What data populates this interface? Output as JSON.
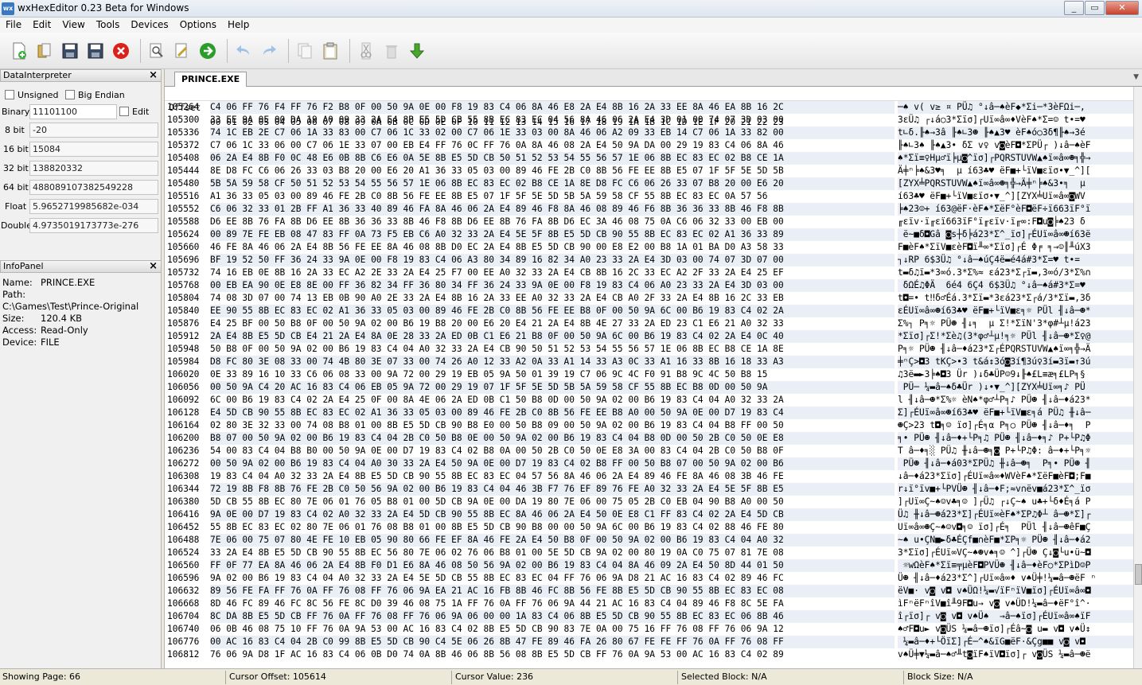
{
  "window": {
    "title": "wxHexEditor 0.23 Beta for Windows",
    "icon_text": "wx"
  },
  "menu": [
    "File",
    "Edit",
    "View",
    "Tools",
    "Devices",
    "Options",
    "Help"
  ],
  "toolbar": [
    {
      "name": "new-file-icon"
    },
    {
      "name": "open-file-icon"
    },
    {
      "name": "save-icon"
    },
    {
      "name": "save-as-icon"
    },
    {
      "name": "close-file-icon"
    },
    {
      "name": "find-icon"
    },
    {
      "name": "replace-icon"
    },
    {
      "name": "goto-icon"
    },
    {
      "name": "undo-icon"
    },
    {
      "name": "redo-icon"
    },
    {
      "name": "copy-icon"
    },
    {
      "name": "paste-icon"
    },
    {
      "name": "cut-icon"
    },
    {
      "name": "delete-icon"
    },
    {
      "name": "insert-icon"
    }
  ],
  "data_interpreter": {
    "title": "DataInterpreter",
    "unsigned_label": "Unsigned",
    "big_endian_label": "Big Endian",
    "edit_label": "Edit",
    "rows": [
      {
        "label": "Binary",
        "value": "11101100"
      },
      {
        "label": "8 bit",
        "value": "-20"
      },
      {
        "label": "16 bit",
        "value": "15084"
      },
      {
        "label": "32 bit",
        "value": "138820332"
      },
      {
        "label": "64 bit",
        "value": "488089107382549228"
      },
      {
        "label": "Float",
        "value": "5.9652719985682e-034"
      },
      {
        "label": "Double",
        "value": "4.9735019173773e-276"
      }
    ]
  },
  "info_panel": {
    "title": "InfoPanel",
    "lines": [
      {
        "label": "Name:",
        "value": "PRINCE.EXE"
      },
      {
        "label": "Path:",
        "value": ""
      },
      {
        "label": "",
        "value": "C:\\Games\\Test\\Prince-Original"
      },
      {
        "label": "Size:",
        "value": "120.4 KB"
      },
      {
        "label": "Access:",
        "value": "Read-Only"
      },
      {
        "label": "Device:",
        "value": "FILE"
      }
    ]
  },
  "tab": {
    "label": "PRINCE.EXE"
  },
  "hex_header": {
    "offset_label": "Offset",
    "columns": "00 01 02 03 04 05 06 07 08 09 0A 0B 0C 0D 0E 0F 10 11 12 13 14 15 16 17 18 19 1A 1B 1C 1D 1E 1F 20 21 22 23",
    "ascii_header": "0123456789ABCDEF0123456789ABCDEF0123"
  },
  "hex_rows": [
    {
      "off": "105264",
      "hex": "C4 06 FF 76 F4 FF 76 F2 B8 0F 00 50 9A 0E 00 F8 19 83 C4 06 8A 46 E8 2A E4 8B 16 2A 33 EE 8A 46 EA 8B 16 2C",
      "asc": "─♠ v( v≥ ¤ PÜ♫ °↓â─♠èF◆*Σi─*3èFΩi─,"
    },
    {
      "off": "105300",
      "hex": "33 EE 9A 0E 00 DA 19 A0 09 33 2A E4 8B E5 5D CB 55 8B EC 83 EC 04 56 8A 46 06 2A E4 3D 01 00 74 07 3D 03 00",
      "asc": "3εÜ♫ ┌↓á○3*Σïσ]┌Uï∞â∞♦VèF♠*Σ=☺ t•=♥"
    },
    {
      "off": "105336",
      "hex": "74 1C EB 2E C7 06 1A 33 83 00 C7 06 1C 33 02 00 C7 06 1E 33 03 00 8A 46 06 A2 09 33 EB 14 C7 06 1A 33 82 00",
      "asc": "t∟δ.╟♠→3â ╟♠∟3☻ ╟♠▲3♥ èF♠ó○3δ¶╟♠→3é"
    },
    {
      "off": "105372",
      "hex": "C7 06 1C 33 06 00 C7 06 1E 33 07 00 EB E4 FF 76 0C FF 76 0A 8A 46 08 2A E4 50 9A DA 00 29 19 83 C4 06 8A 46",
      "asc": "╟♠∟3♠ ╟♠▲3• δΣ v♀ v◙èF◘*ΣPÜ┌ )↓â─♠èF"
    },
    {
      "off": "105408",
      "hex": "06 2A E4 8B F0 0C 48 E6 0B 8B C6 E6 0A 5E 8B E5 5D CB 50 51 52 53 54 55 56 57 1E 06 8B EC 83 EC 02 B8 CE 1A",
      "asc": "♠*Σï≡♀Hµ♂ï╞µ◙^ïσ]┌PQRSTUVW▲♠ï∞â∞☻╕╬→"
    },
    {
      "off": "105444",
      "hex": "8E D8 FC C6 06 26 33 03 B8 20 00 E6 20 A1 36 33 05 03 00 89 46 FE 2B C0 8B 56 FE EE 8B E5 07 1F 5F 5E 5D 5B",
      "asc": "Ä╪ⁿ╞♠&3♥╕  µ í63♣♥ ëF■+└ïV■εïσ•▼_^]["
    },
    {
      "off": "105480",
      "hex": "5B 5A 59 58 CF 50 51 52 53 54 55 56 57 1E 06 8B EC 83 EC 02 B8 CE 1A 8E D8 FC C6 06 26 33 07 B8 20 00 E6 20",
      "asc": "[ZYX╧PQRSTUVW▲♠ï∞â∞☻╕╬→Ä╪ⁿ╞♠&3•╕  µ"
    },
    {
      "off": "105516",
      "hex": "A1 36 33 05 03 00 89 46 FE 2B C0 8B 56 FE EE 8B E5 07 1F 5F 5E 5D 5B 5A 59 58 CF 55 8B EC 83 EC 0A 57 56",
      "asc": "í63♣♥ ëF■+└ïV■εïσ•▼_^][ZYX╧Uï∞â∞◙WV"
    },
    {
      "off": "105552",
      "hex": "C6 06 32 33 01 2B FF A1 36 33 40 89 46 FA 8A 46 06 2A E4 89 46 F8 8A 46 08 89 46 F6 8B 36 36 33 8B 46 F8 8B",
      "asc": "╞♠23☺+ í63@ëF·èF♠*ΣëF°èF◘ëF÷ï663ïF°ï"
    },
    {
      "off": "105588",
      "hex": "D6 EE 8B 76 FA 8B D6 EE 8B 36 36 33 8B 46 F8 8B D6 EE 8B 76 FA 8B D6 EC 3A 46 08 75 0A C6 06 32 33 00 EB 00",
      "asc": "╓εïv·ï╓εï663ïF°ï╓εïv·ï╓∞:F◘u◙╞♠23 δ"
    },
    {
      "off": "105624",
      "hex": "00 89 7E FE EB 08 47 83 FF 0A 73 F5 EB C6 A0 32 33 2A E4 5E 5F 8B E5 5D CB 90 55 8B EC 83 EC 02 A1 36 33 89",
      "asc": " ë~■δ◘Gâ ◙s┼δ╞á23*Σ^_ïσ]┌ÉUï∞â∞☻í63ë"
    },
    {
      "off": "105660",
      "hex": "46 FE 8A 46 06 2A E4 8B 56 FE EE 8A 46 08 8B D0 EC 2A E4 8B E5 5D CB 90 00 E8 E2 00 B8 1A 01 BA D0 A3 58 33",
      "asc": "F■èF♠*ΣïV■εèF◘ï╨∞*Σïσ]┌É Φ╒ ╕→☺║╨úX3"
    },
    {
      "off": "105696",
      "hex": "BF 19 52 50 FF 36 24 33 9A 0E 00 F8 19 83 C4 06 A3 80 34 89 16 82 34 A0 23 33 2A E4 3D 03 00 74 07 3D 07 00",
      "asc": "┐↓RP 6$3Ü♫ °↓â─♠úÇ4ë▬é4á#3*Σ=♥ t•="
    },
    {
      "off": "105732",
      "hex": "74 16 EB 0E 8B 16 2A 33 EC A2 2E 33 2A E4 25 F7 00 EE A0 32 33 2A E4 CB 8B 16 2C 33 EC A2 2F 33 2A E4 25 EF",
      "asc": "t▬δ♫ï▬*3∞ó.3*Σ%≈ εá23*Σ┌ï▬,3∞ó/3*Σ%∩"
    },
    {
      "off": "105768",
      "hex": "00 EB EA 90 0E E8 8E 00 FF 36 82 34 FF 36 80 34 FF 36 24 33 9A 0E 00 F8 19 83 C4 06 A0 23 33 2A E4 3D 03 00",
      "asc": " δΩÉ♫ΦÄ  6é4 6Ç4 6$3Ü♫ °↓â─♠á#3*Σ=♥"
    },
    {
      "off": "105804",
      "hex": "74 08 3D 07 00 74 13 EB 0B 90 A0 2E 33 2A E4 8B 16 2A 33 EE A0 32 33 2A E4 CB A0 2F 33 2A E4 8B 16 2C 33 EB",
      "asc": "t◘=• t‼δ♂Éá.3*Σï▬*3εá23*Σ┌á/3*Σï▬,3δ"
    },
    {
      "off": "105840",
      "hex": "EE 90 55 8B EC 83 EC 02 A1 36 33 05 03 00 89 46 FE 2B C0 8B 56 FE EE B8 0F 00 50 9A 6C 00 B6 19 83 C4 02 2A",
      "asc": "εÉUï∞â∞☻í63♣♥ ëF■+└ïV■ε╕☼ PÜl ╢↓â─☻*"
    },
    {
      "off": "105876",
      "hex": "E4 25 BF 00 50 B8 0F 00 50 9A 02 00 B6 19 B8 20 00 E6 20 E4 21 2A E4 8B 4E 27 33 2A ED 23 C1 E6 21 A0 32 33",
      "asc": "Σ%┐ P╕☼ PÜ☻ ╢↓╕  µ Σ!*ΣïN'3*φ#┴µ!á23"
    },
    {
      "off": "105912",
      "hex": "2A E4 8B E5 5D CB E4 21 2A E4 8A 0E 28 33 2A ED 0B C1 E6 21 B8 0F 00 50 9A 6C 00 B6 19 83 C4 02 2A E4 0C 40",
      "asc": "*Σïσ]┌Σ!*Σè♫(3*φ♂┴µ!╕☼ PÜl ╢↓â─☻*Σ♀@"
    },
    {
      "off": "105948",
      "hex": "50 B8 0F 00 50 9A 02 00 B6 19 83 C4 04 A0 32 33 2A E4 CB 90 50 51 52 53 54 55 56 57 1E 06 8B EC B8 CE 1A 8E",
      "asc": "P╕☼ PÜ☻ ╢↓â─♦á23*Σ┌ÉPQRSTUVW▲♠ï∞╕╬→Ä"
    },
    {
      "off": "105984",
      "hex": "D8 FC 80 3E 08 33 00 74 4B 80 3E 07 33 00 74 26 A0 12 33 A2 0A 33 A1 14 33 A3 0C 33 A1 16 33 8B 16 18 33 A3",
      "asc": "╪ⁿÇ>◘3 tKÇ>•3 t&á↕3ó◙3í¶3ú♀3í▬3ï▬↑3ú"
    },
    {
      "off": "106020",
      "hex": "0E 33 89 16 10 33 C6 06 08 33 00 9A 72 00 29 19 EB 05 9A 50 01 39 19 C7 06 9C 4C F0 91 B8 9C 4C 50 B8 15",
      "asc": "♫3ë▬►3╞♠◘3 Ür )↓δ♣ÜP☺9↓╟♠£L≡æ╕£LP╕§"
    },
    {
      "off": "106056",
      "hex": "00 50 9A C4 20 AC 16 83 C4 06 EB 05 9A 72 00 29 19 07 1F 5F 5E 5D 5B 5A 59 58 CF 55 8B EC B8 0D 00 50 9A",
      "asc": " PÜ─ ¼▬â─♠δ♣Ür )↓•▼_^][ZYX╧Uï∞╕♪ PÜ"
    },
    {
      "off": "106092",
      "hex": "6C 00 B6 19 83 C4 02 2A E4 25 0F 00 8A 4E 06 2A ED 0B C1 50 B8 0D 00 50 9A 02 00 B6 19 83 C4 04 A0 32 33 2A",
      "asc": "l ╢↓â─☻*Σ%☼ èN♠*φ♂┴P╕♪ PÜ☻ ╢↓â─♦á23*"
    },
    {
      "off": "106128",
      "hex": "E4 5D CB 90 55 8B EC 83 EC 02 A1 36 33 05 03 00 89 46 FE 2B C0 8B 56 FE EE B8 A0 00 50 9A 0E 00 D7 19 83 C4",
      "asc": "Σ]┌ÉUï∞â∞☻í63♣♥ ëF■+└ïV■ε╕á PÜ♫ ╫↓â─"
    },
    {
      "off": "106164",
      "hex": "02 80 3E 32 33 00 74 08 B8 01 00 8B E5 5D CB 90 B8 E0 00 50 B8 09 00 50 9A 02 00 B6 19 83 C4 04 B8 FF 00 50",
      "asc": "☻Ç>23 t◘╕☺ ïσ]┌É╕α P╕○ PÜ☻ ╢↓â─♦╕  P"
    },
    {
      "off": "106200",
      "hex": "B8 07 00 50 9A 02 00 B6 19 83 C4 04 2B C0 50 B8 0E 00 50 9A 02 00 B6 19 83 C4 04 B8 0D 00 50 2B C0 50 0E E8",
      "asc": "╕• PÜ☻ ╢↓â─♦+└P╕♫ PÜ☻ ╢↓â─♦╕♪ P+└P♫Φ"
    },
    {
      "off": "106236",
      "hex": "54 00 83 C4 04 B8 B0 00 50 9A 0E 00 D7 19 83 C4 02 B8 0A 00 50 2B C0 50 0E E8 3A 00 83 C4 04 2B C0 50 B8 0F",
      "asc": "T â─♦╕░ PÜ♫ ╫↓â─☻╕◙ P+└P♫Φ: â─♦+└P╕☼"
    },
    {
      "off": "106272",
      "hex": "00 50 9A 02 00 B6 19 83 C4 04 A0 30 33 2A E4 50 9A 0E 00 D7 19 83 C4 02 B8 FF 00 50 B8 07 00 50 9A 02 00 B6",
      "asc": " PÜ☻ ╢↓â─♦á03*ΣPÜ♫ ╫↓â─☻╕  P╕• PÜ☻ ╢"
    },
    {
      "off": "106308",
      "hex": "19 83 C4 04 A0 32 33 2A E4 8B E5 5D CB 90 55 8B EC 83 EC 04 57 56 8A 46 06 2A E4 89 46 FE 8A 46 08 3B 46 FE",
      "asc": "↓â─♦á23*Σïσ]┌ÉUï∞â∞♦WVèF♠*ΣëF■èF◘;F■"
    },
    {
      "off": "106344",
      "hex": "72 19 8B F8 8B 76 FE 2B C0 50 56 9A 02 00 B6 19 83 C4 04 46 3B F7 76 EF 89 76 FE A0 32 33 2A E4 5E 5F 8B E5",
      "asc": "r↓ï°ïv■+└PVÜ☻ ╢↓â─♦F;≈v∩ëv■á23*Σ^_ïσ"
    },
    {
      "off": "106380",
      "hex": "5D CB 55 8B EC 80 7E 06 01 76 05 B8 01 00 5D CB 9A 0E 00 DA 19 80 7E 06 00 75 05 2B C0 EB 04 90 B8 A0 00 50",
      "asc": "]┌Uï∞Ç~♠☺v♣╕☺ ]┌Ü♫ ┌↓Ç~♠ u♣+└δ♦É╕á P"
    },
    {
      "off": "106416",
      "hex": "9A 0E 00 D7 19 83 C4 02 A0 32 33 2A E4 5D CB 90 55 8B EC 8A 46 06 2A E4 50 0E E8 C1 FF 83 C4 02 2A E4 5D CB",
      "asc": "Ü♫ ╫↓â─☻á23*Σ]┌ÉUï∞èF♠*ΣP♫Φ┴ â─☻*Σ]┌"
    },
    {
      "off": "106452",
      "hex": "55 8B EC 83 EC 02 80 7E 06 01 76 08 B8 01 00 8B E5 5D CB 90 B8 00 00 50 9A 6C 00 B6 19 83 C4 02 88 46 FE 80",
      "asc": "Uï∞â∞☻Ç~♠☺v◘╕☺ ïσ]┌É╕  PÜl ╢↓â─☻êF■Ç"
    },
    {
      "off": "106488",
      "hex": "7E 06 00 75 07 80 4E FE 10 EB 05 90 80 66 FE EF 8A 46 FE 2A E4 50 B8 0F 00 50 9A 02 00 B6 19 83 C4 04 A0 32",
      "asc": "~♠ u•ÇN■►δ♣ÉÇf■∩èF■*ΣP╕☼ PÜ☻ ╢↓â─♦á2"
    },
    {
      "off": "106524",
      "hex": "33 2A E4 8B E5 5D CB 90 55 8B EC 56 80 7E 06 02 76 06 B8 01 00 5E 5D CB 9A 02 00 80 19 0A C0 75 07 81 7E 08",
      "asc": "3*Σïσ]┌ÉUï∞VÇ~♠☻v♠╕☺ ^]┌Ü☻ Ç↓◙└u•ü~◘"
    },
    {
      "off": "106560",
      "hex": "FF 0F 77 EA 8A 46 06 2A E4 8B F0 D1 E6 8A 46 08 50 56 9A 02 00 B6 19 83 C4 04 8A 46 09 2A E4 50 8D 44 01 50",
      "asc": " ☼wΩèF♠*Σï≡╤µèF◘PVÜ☻ ╢↓â─♦èF○*ΣPìD☺P"
    },
    {
      "off": "106596",
      "hex": "9A 02 00 B6 19 83 C4 04 A0 32 33 2A E4 5E 5D CB 55 8B EC 83 EC 04 FF 76 06 9A D8 21 AC 16 83 C4 02 89 46 FC",
      "asc": "Ü☻ ╢↓â─♦á23*Σ^]┌Uï∞â∞♦ v♠Ü╪!¼▬â─☻ëF ⁿ"
    },
    {
      "off": "106632",
      "hex": "89 56 FE FA FF 76 0A FF 76 08 FF 76 06 9A EA 21 AC 16 FB 8B 46 FC 8B 56 FE 8B E5 5D CB 90 55 8B EC 83 EC 08",
      "asc": "ëV■· v◙ v◘ v♠ÜΩ!¼▬√ïFⁿïV■ïσ]┌ÉUï∞â∞◘"
    },
    {
      "off": "106668",
      "hex": "8D 46 FC 89 46 FC 8C 56 FE 8C D0 39 46 08 75 1A FF 76 0A FF 76 06 9A 44 21 AC 16 83 C4 04 89 46 F8 8C 5E FA",
      "asc": "ìFⁿëFⁿîV■î╨9F◘u→ v◙ v♠ÜD!¼▬â─♦ëF°î^·"
    },
    {
      "off": "106704",
      "hex": "8C DA 8B E5 5D CB FF 76 0A FF 76 08 FF 76 06 9A 06 00 00 1A 83 C4 06 8B E5 5D CB 90 55 8B EC 83 EC 06 8B 46",
      "asc": "î┌ïσ]┌ v◙ v◘ v♠Ü♠  →â─♠ïσ]┌ÉUï∞â∞♠ïF"
    },
    {
      "off": "106740",
      "hex": "06 0B 46 08 75 10 FF 76 0A 9A 53 00 AC 16 83 C4 02 8B E5 5D CB 90 83 7E 0A 00 75 16 FF 76 08 FF 76 06 9A 12",
      "asc": "♠♂F◘u► v◙ÜS ¼▬â─☻ïσ]┌Éâ~◙ u▬ v◘ v♠Ü↕"
    },
    {
      "off": "106776",
      "hex": "00 AC 16 83 C4 04 2B C0 99 8B E5 5D CB 90 C4 5E 06 26 8B 47 FE 89 46 FA 26 80 67 FE FE FF 76 0A FF 76 08 FF",
      "asc": " ¼▬â─♦+└ÖïΣ]┌É─^♠&ïG■ëF·&Çg■■ v◙ v◘"
    },
    {
      "off": "106812",
      "hex": "76 06 9A D8 1F AC 16 83 C4 06 0B D0 74 0A 8B 46 06 8B 56 08 8B E5 5D CB FF 76 0A 9A 53 00 AC 16 83 C4 02 89",
      "asc": "v♠Ü╪▼¼▬â─♠♂╨t◙ïF♠ïV◘ïσ]┌ v◙ÜS ¼▬â─☻ë"
    }
  ],
  "status": {
    "page": "Showing Page: 66",
    "cursor_offset": "Cursor Offset: 105614",
    "cursor_value": "Cursor Value: 236",
    "selected_block": "Selected Block: N/A",
    "block_size": "Block Size: N/A"
  },
  "colors": {
    "row_band": "#eaeef7",
    "titlebar": "#dfe6ee",
    "panel": "#f0f0f0"
  }
}
